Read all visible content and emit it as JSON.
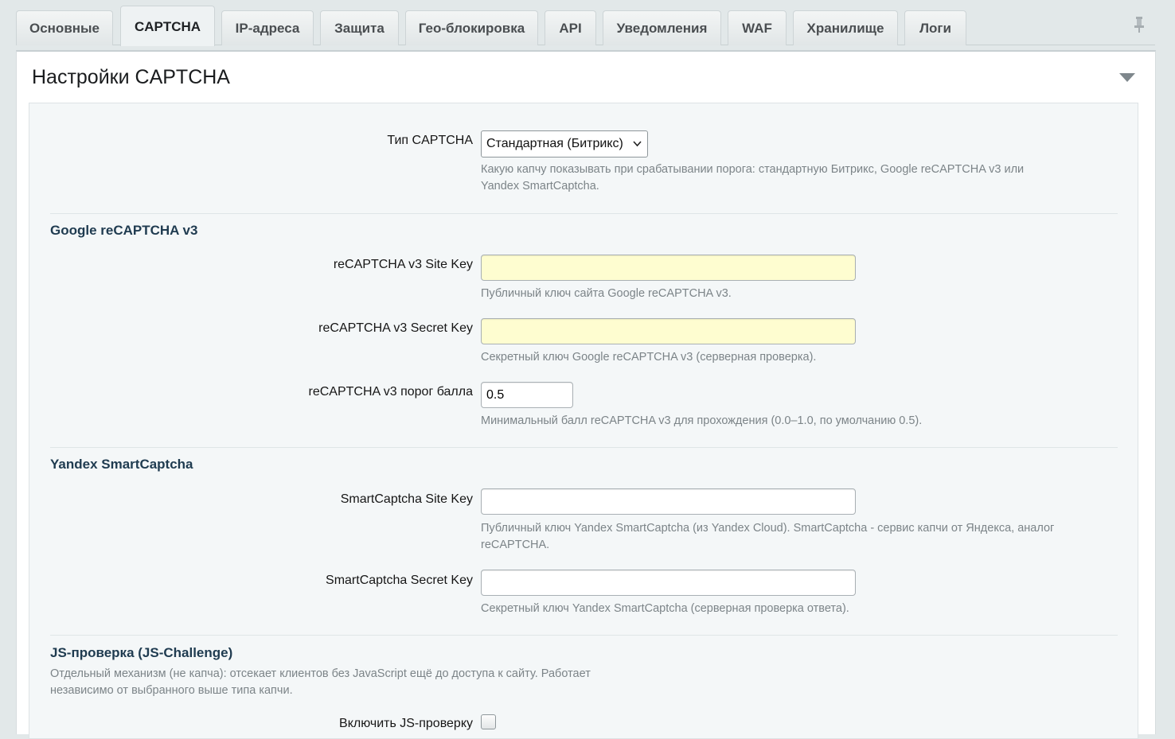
{
  "tabs": [
    {
      "label": "Основные",
      "active": false
    },
    {
      "label": "CAPTCHA",
      "active": true
    },
    {
      "label": "IP-адреса",
      "active": false
    },
    {
      "label": "Защита",
      "active": false
    },
    {
      "label": "Гео-блокировка",
      "active": false
    },
    {
      "label": "API",
      "active": false
    },
    {
      "label": "Уведомления",
      "active": false
    },
    {
      "label": "WAF",
      "active": false
    },
    {
      "label": "Хранилище",
      "active": false
    },
    {
      "label": "Логи",
      "active": false
    }
  ],
  "panel": {
    "title": "Настройки CAPTCHA"
  },
  "captcha_type": {
    "label": "Тип CAPTCHA",
    "selected": "Стандартная (Битрикс)",
    "help": "Какую капчу показывать при срабатывании порога: стандартную Битрикс, Google reCAPTCHA v3 или Yandex SmartCaptcha."
  },
  "recaptcha": {
    "title": "Google reCAPTCHA v3",
    "site_key": {
      "label": "reCAPTCHA v3 Site Key",
      "value": "",
      "help": "Публичный ключ сайта Google reCAPTCHA v3."
    },
    "secret_key": {
      "label": "reCAPTCHA v3 Secret Key",
      "value": "",
      "help": "Секретный ключ Google reCAPTCHA v3 (серверная проверка)."
    },
    "threshold": {
      "label": "reCAPTCHA v3 порог балла",
      "value": "0.5",
      "help": "Минимальный балл reCAPTCHA v3 для прохождения (0.0–1.0, по умолчанию 0.5)."
    }
  },
  "smartcaptcha": {
    "title": "Yandex SmartCaptcha",
    "site_key": {
      "label": "SmartCaptcha Site Key",
      "value": "",
      "help": "Публичный ключ Yandex SmartCaptcha (из Yandex Cloud). SmartCaptcha - сервис капчи от Яндекса, аналог reCAPTCHA."
    },
    "secret_key": {
      "label": "SmartCaptcha Secret Key",
      "value": "",
      "help": "Секретный ключ Yandex SmartCaptcha (серверная проверка ответа)."
    }
  },
  "js_check": {
    "title": "JS-проверка (JS-Challenge)",
    "description": "Отдельный механизм (не капча): отсекает клиентов без JavaScript ещё до доступа к сайту. Работает независимо от выбранного выше типа капчи.",
    "enable_label": "Включить JS-проверку",
    "enabled": false
  },
  "colors": {
    "accent": "#1f3b50",
    "input_highlight": "#fefdd0",
    "background": "#e2e8e9"
  },
  "icons": {
    "pin": "pin-icon",
    "collapse": "triangle-down-icon",
    "select": "chevron-down-icon"
  }
}
